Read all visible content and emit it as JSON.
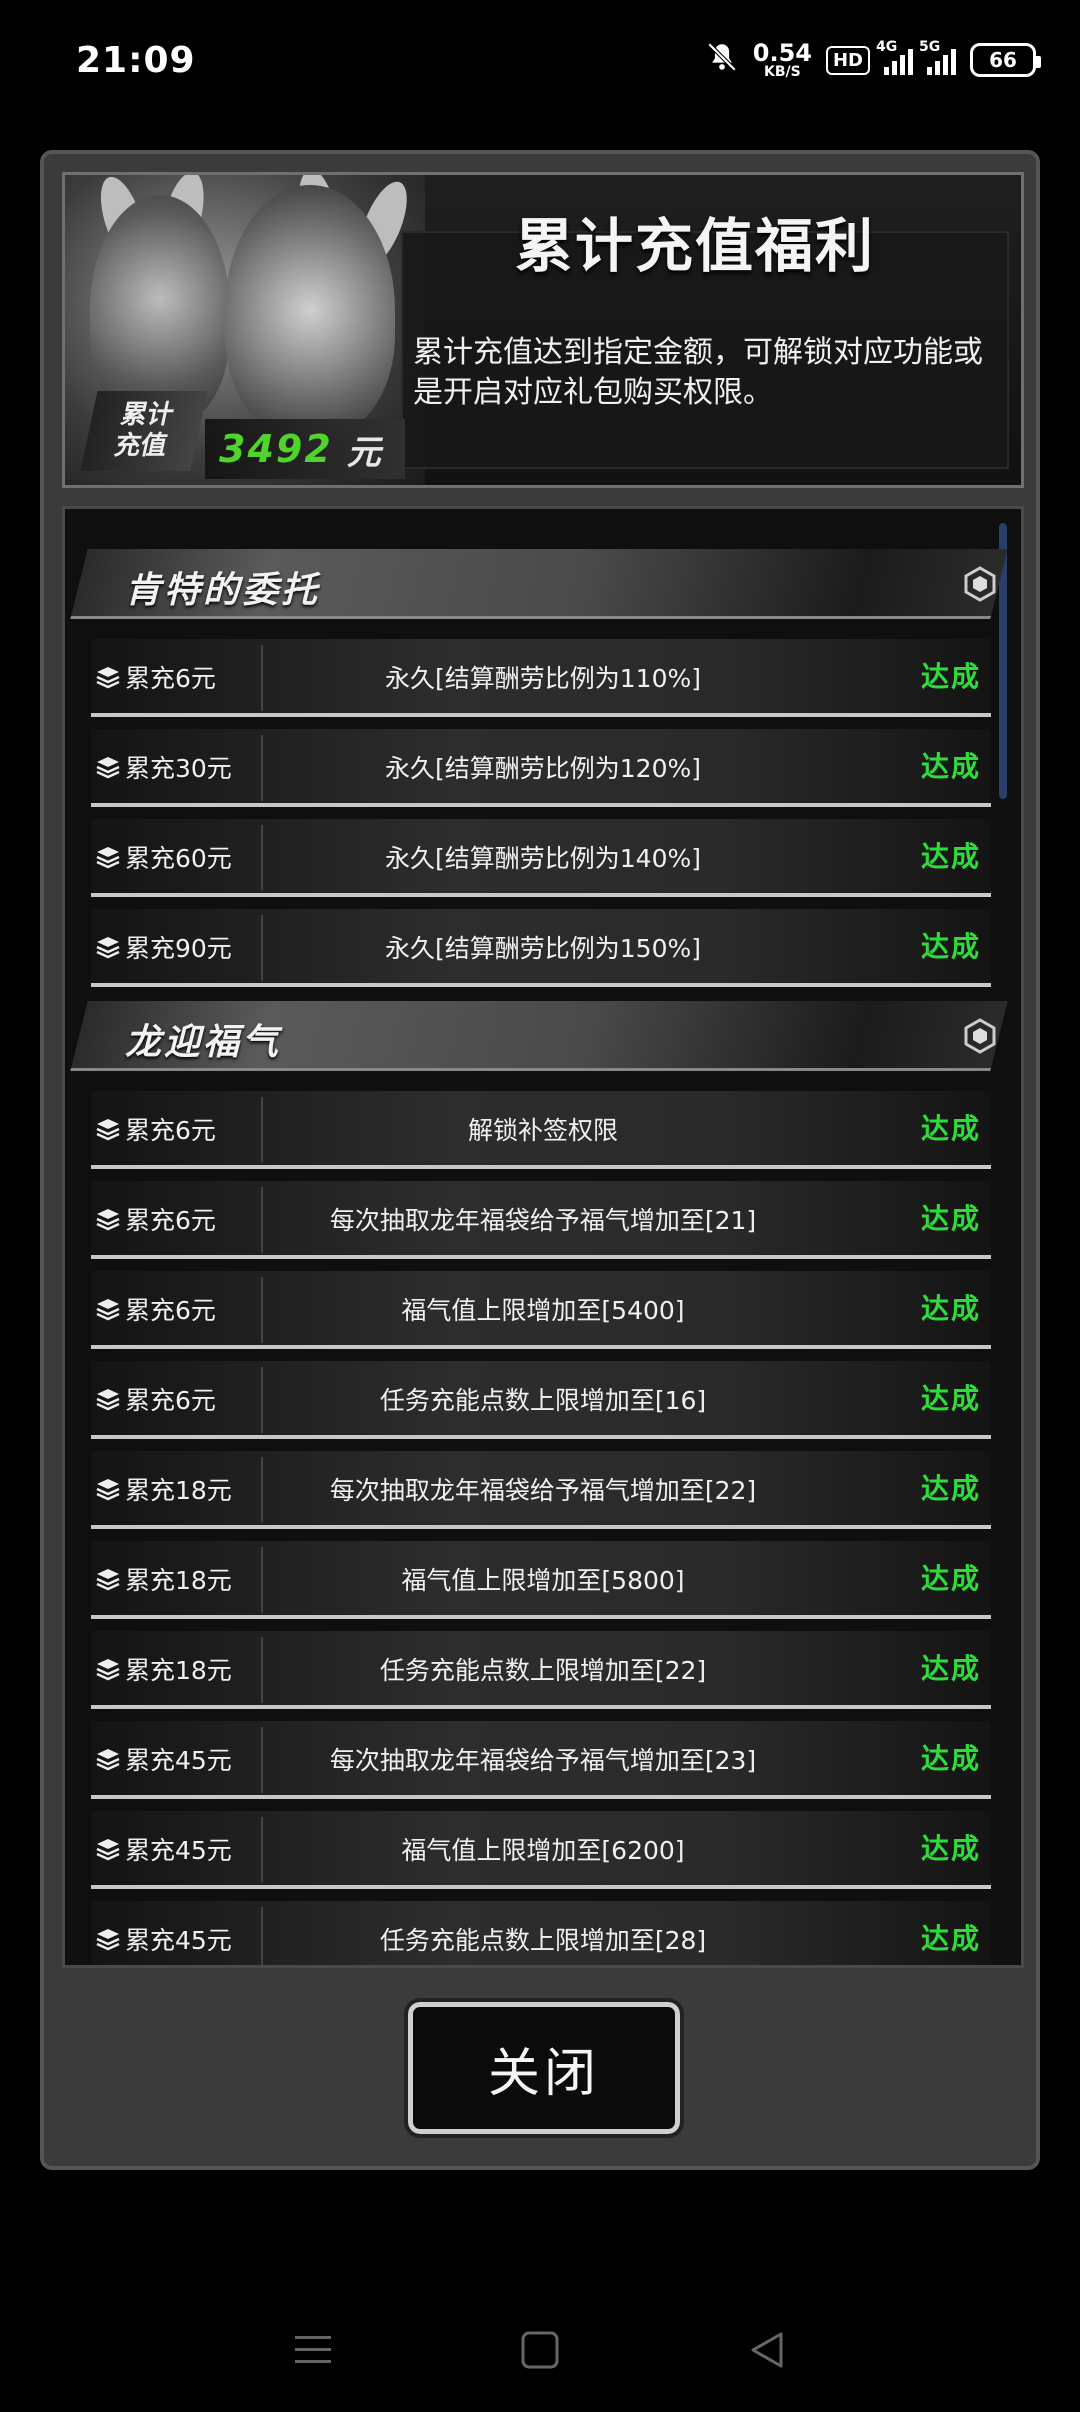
{
  "status_bar": {
    "time": "21:09",
    "net_speed_value": "0.54",
    "net_speed_unit": "KB/S",
    "hd_label": "HD",
    "sim1_label": "4G",
    "sim2_label": "5G",
    "battery": "66"
  },
  "header": {
    "title": "累计充值福利",
    "description": "累计充值达到指定金额，可解锁对应功能或是开启对应礼包购买权限。",
    "recharge_label_line1": "累计",
    "recharge_label_line2": "充值",
    "recharge_value": "3492",
    "recharge_unit": "元"
  },
  "sections": [
    {
      "title": "肯特的委托",
      "rows": [
        {
          "req": "累充6元",
          "reward": "永久[结算酬劳比例为110%]",
          "status": "达成"
        },
        {
          "req": "累充30元",
          "reward": "永久[结算酬劳比例为120%]",
          "status": "达成"
        },
        {
          "req": "累充60元",
          "reward": "永久[结算酬劳比例为140%]",
          "status": "达成"
        },
        {
          "req": "累充90元",
          "reward": "永久[结算酬劳比例为150%]",
          "status": "达成"
        }
      ]
    },
    {
      "title": "龙迎福气",
      "rows": [
        {
          "req": "累充6元",
          "reward": "解锁补签权限",
          "status": "达成"
        },
        {
          "req": "累充6元",
          "reward": "每次抽取龙年福袋给予福气增加至[21]",
          "status": "达成"
        },
        {
          "req": "累充6元",
          "reward": "福气值上限增加至[5400]",
          "status": "达成"
        },
        {
          "req": "累充6元",
          "reward": "任务充能点数上限增加至[16]",
          "status": "达成"
        },
        {
          "req": "累充18元",
          "reward": "每次抽取龙年福袋给予福气增加至[22]",
          "status": "达成"
        },
        {
          "req": "累充18元",
          "reward": "福气值上限增加至[5800]",
          "status": "达成"
        },
        {
          "req": "累充18元",
          "reward": "任务充能点数上限增加至[22]",
          "status": "达成"
        },
        {
          "req": "累充45元",
          "reward": "每次抽取龙年福袋给予福气增加至[23]",
          "status": "达成"
        },
        {
          "req": "累充45元",
          "reward": "福气值上限增加至[6200]",
          "status": "达成"
        },
        {
          "req": "累充45元",
          "reward": "任务充能点数上限增加至[28]",
          "status": "达成"
        }
      ]
    }
  ],
  "close_button": "关闭",
  "colors": {
    "status_green": "#2edc3a",
    "recharge_green": "#4ed42a",
    "panel_bg": "#3b3b3b"
  },
  "icons": {
    "section": "hexagon-icon",
    "row": "stack-layers-icon",
    "nav": [
      "menu-icon",
      "home-square-icon",
      "back-triangle-icon"
    ]
  }
}
